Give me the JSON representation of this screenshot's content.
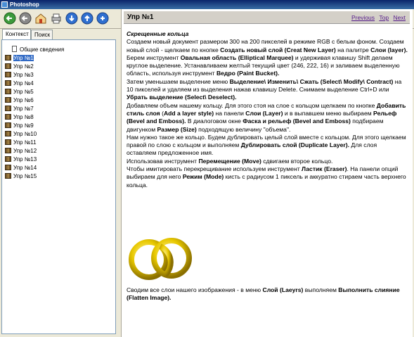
{
  "window": {
    "title": "Photoshop"
  },
  "toolbar": {
    "buttons": [
      {
        "name": "hide-button",
        "icon": "arrow-left-icon"
      },
      {
        "name": "back-button",
        "icon": "arrow-circle-left-icon"
      },
      {
        "name": "home-button",
        "icon": "home-icon"
      },
      {
        "name": "print-button",
        "icon": "print-icon"
      },
      {
        "name": "prev-button",
        "icon": "arrow-down-icon"
      },
      {
        "name": "next-button",
        "icon": "arrow-up-icon"
      },
      {
        "name": "options-button",
        "icon": "options-icon"
      }
    ]
  },
  "tabs": {
    "contents": "Контекст",
    "search": "Поиск"
  },
  "tree": {
    "items": [
      "Общие сведения",
      "Упр №1",
      "Упр №2",
      "Упр №3",
      "Упр №4",
      "Упр №5",
      "Упр №6",
      "Упр №7",
      "Упр №8",
      "Упр №9",
      "Упр №10",
      "Упр №11",
      "Упр №12",
      "Упр №13",
      "Упр №14",
      "Упр №15"
    ]
  },
  "topic": {
    "title": "Упр №1",
    "nav": {
      "previous": "Previous",
      "top": "Top",
      "next": "Next"
    },
    "subtitle": "Скрещенные кольца"
  },
  "colors": {
    "ring": "#E8C800",
    "titlebar": "#0A246A",
    "selected": "#316AC5"
  }
}
